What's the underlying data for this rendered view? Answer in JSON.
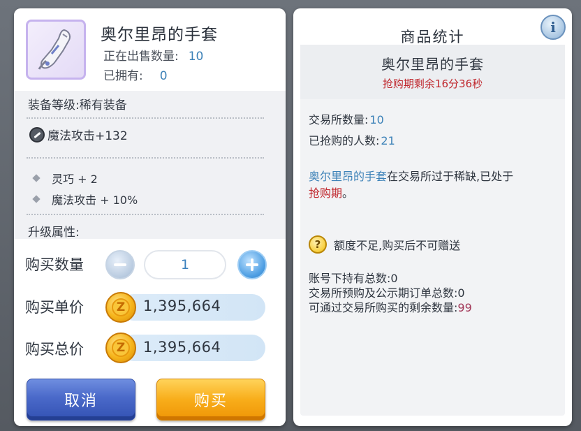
{
  "purchase_dialog": {
    "item_name": "奥尔里昂的手套",
    "on_sale_label": "正在出售数量:",
    "on_sale_value": "10",
    "owned_label": "已拥有:",
    "owned_value": "0",
    "equip_level": "装备等级:稀有装备",
    "main_stat": "魔法攻击+132",
    "bonus_stats": [
      "灵巧 + 2",
      "魔法攻击 + 10%"
    ],
    "upgrade_label": "升级属性:",
    "qty_label": "购买数量",
    "quantity": "1",
    "unit_price_label": "购买单价",
    "unit_price": "1,395,664",
    "total_price_label": "购买总价",
    "total_price": "1,395,664",
    "coin_glyph": "Z",
    "cancel_label": "取消",
    "buy_label": "购买"
  },
  "stats_panel": {
    "title": "商品统计",
    "info_glyph": "i",
    "item_name": "奥尔里昂的手套",
    "timer": "抢购期剩余16分36秒",
    "exchange_count_label": "交易所数量:",
    "exchange_count": "10",
    "buyers_label": "已抢购的人数:",
    "buyers": "21",
    "desc_item": "奥尔里昂的手套",
    "desc_middle": "在交易所过于稀缺,已处于",
    "desc_period": "抢购期",
    "desc_end": "。",
    "warn_glyph": "?",
    "warning": "额度不足,购买后不可赠送",
    "account_total": "账号下持有总数:0",
    "preorder_total": "交易所预购及公示期订单总数:0",
    "remaining_label": "可通过交易所购买的剩余数量:",
    "remaining": "99"
  },
  "colors": {
    "accent_blue": "#3d82b8",
    "alert_red": "#c0272d",
    "cancel_blue": "#4a69c9",
    "buy_orange": "#f8ad1a"
  }
}
